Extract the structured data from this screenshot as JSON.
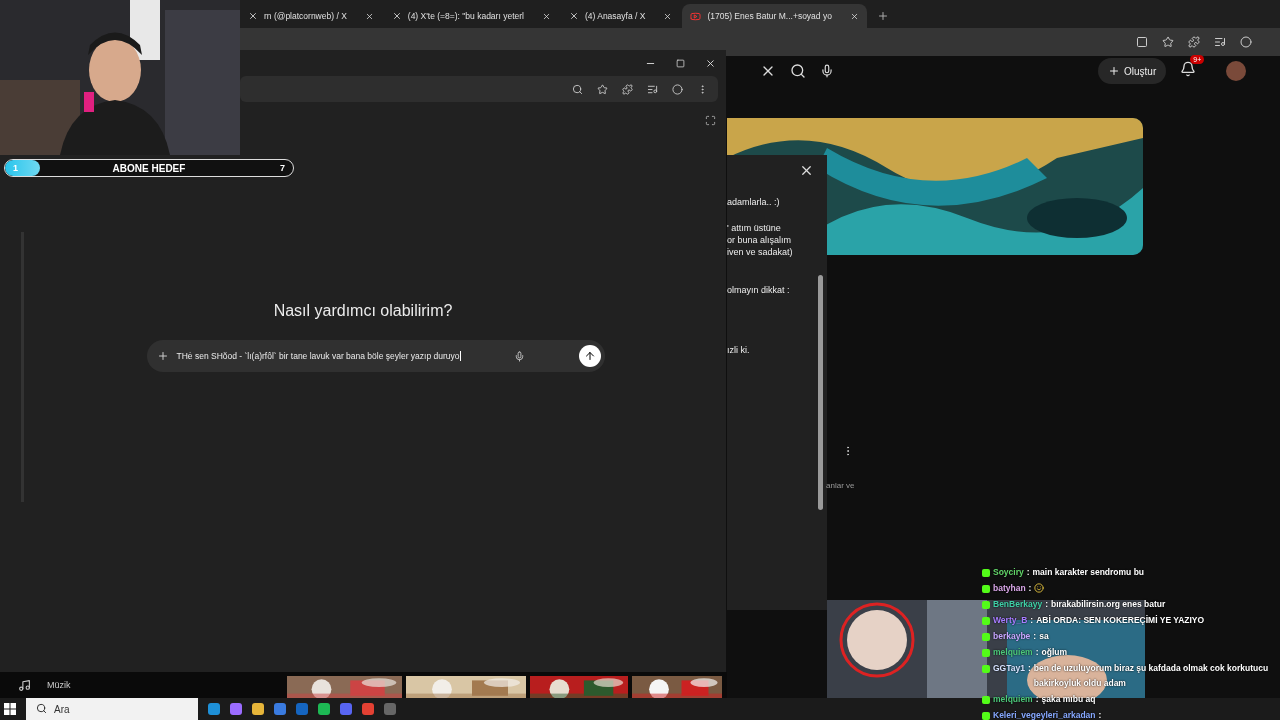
{
  "browser_tabs": [
    {
      "title": "rn (@platcornweb) / X",
      "kind": "x",
      "selected": false
    },
    {
      "title": "(4) X'te (=8=): \"bu kadarı yeterl",
      "kind": "x",
      "selected": false
    },
    {
      "title": "(4) Anasayfa / X",
      "kind": "x",
      "selected": false
    },
    {
      "title": "(1705) Enes Batur M...+soyad yo",
      "kind": "video",
      "selected": true
    }
  ],
  "video_site": {
    "create_label": "Oluştur",
    "notification_badge": "9+"
  },
  "side_panel": {
    "lines": [
      "adamlarla.. :)",
      "' attım üstüne",
      "or buna alışalım",
      "iven ve sadakat)",
      "olmayın dikkat  :",
      "ızli ki."
    ],
    "footer": "anlar ve"
  },
  "assistant": {
    "heading": "Nasıl yardımcı olabilirim?",
    "prompt_value": "THė sen SHŏod - `lı(a)rfôl` bir tane lavuk var bana böle şeyler yazıp duruyo"
  },
  "music_bar": {
    "label": "Müzik"
  },
  "subscriber_goal": {
    "current": "1",
    "label": "ABONE HEDEF",
    "target": "7",
    "level": 0.12
  },
  "stream_chat": [
    {
      "user": "Soyciry",
      "sep": ":",
      "text": "main karakter sendromu bu",
      "kind": "text",
      "color": "#63d66a"
    },
    {
      "user": "batyhan",
      "sep": ":",
      "kind": "emote",
      "color": "#d9a6e8"
    },
    {
      "user": "BenBerkayy",
      "sep": ":",
      "text": "bırakabilirsin.org enes batur",
      "kind": "text",
      "color": "#3fcfa6"
    },
    {
      "user": "Werty_B",
      "sep": ":",
      "text": "ABİ ORDA: SEN KOKEREÇİMİ YE YAZIYO",
      "kind": "text",
      "color": "#a77cff"
    },
    {
      "user": "berkaybe",
      "sep": ":",
      "text": "sa",
      "kind": "text",
      "color": "#c7a6ff"
    },
    {
      "user": "melquiem",
      "sep": ":",
      "text": "oğlum",
      "kind": "text",
      "color": "#4cc87a"
    },
    {
      "user": "GGTay1",
      "sep": ":",
      "text": "ben de uzuluyorum biraz şu kafdada olmak cok korkutucu bakirkoyluk oldu adam",
      "kind": "text",
      "color": "#d6e2ff"
    },
    {
      "user": "melquiem",
      "sep": ":",
      "text": "şaka mıbu aq",
      "kind": "text",
      "color": "#4cc87a"
    },
    {
      "user": "Keleri_vegeyleri_arkadan",
      "sep": ":",
      "kind": "hidden",
      "color": "#86a8ff"
    }
  ],
  "taskbar": {
    "search_placeholder": "Ara"
  }
}
